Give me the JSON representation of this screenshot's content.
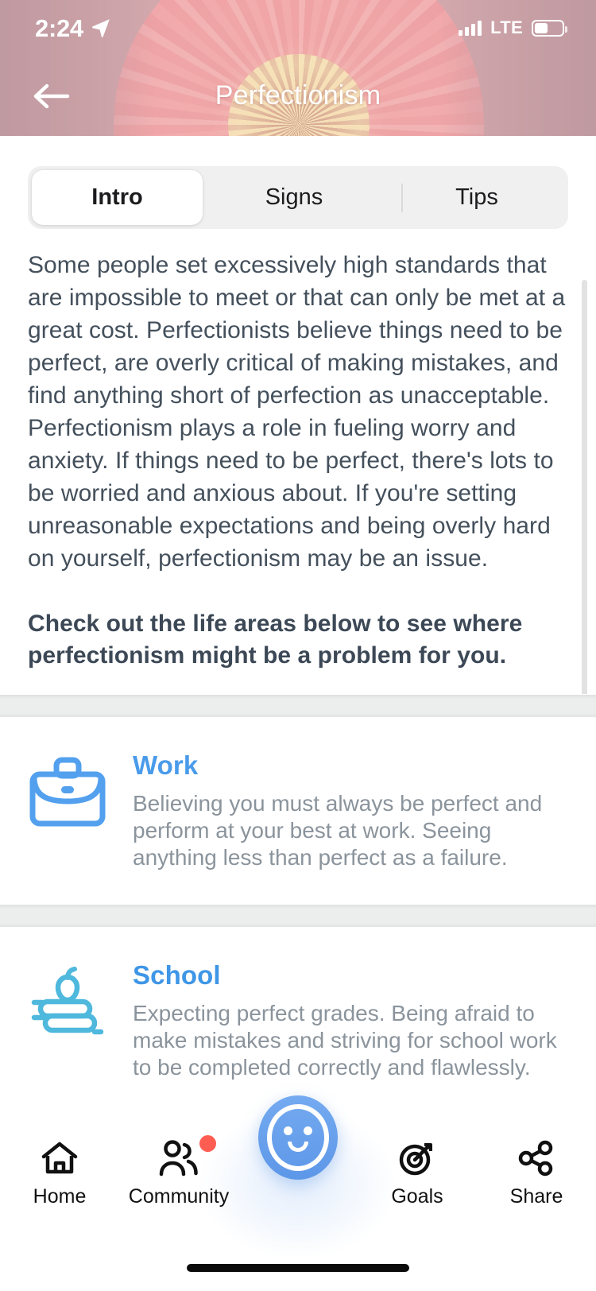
{
  "status_bar": {
    "time": "2:24",
    "location_icon": "location-arrow-icon",
    "signal_icon": "cellular-signal-icon",
    "network": "LTE",
    "battery_icon": "battery-icon"
  },
  "header": {
    "title": "Perfectionism",
    "back_icon": "back-arrow-icon",
    "background_image": "pink-zinnia-flower",
    "colors": {
      "overlay": "#b2838c",
      "flower_petal": "#ef8b8c",
      "flower_center": "#efe3b8"
    }
  },
  "tabs": [
    {
      "label": "Intro",
      "active": true
    },
    {
      "label": "Signs",
      "active": false
    },
    {
      "label": "Tips",
      "active": false
    }
  ],
  "intro": {
    "paragraph": "Some people set excessively high standards that are impossible to meet or that can only be met at a great cost. Perfectionists believe things need to be perfect, are overly critical of making mistakes, and find anything short of perfection as unacceptable. Perfectionism plays a role in fueling worry and anxiety. If things need to be perfect, there's lots to be worried and anxious about. If you're setting unreasonable expectations and being overly hard on yourself, perfectionism may be an issue.",
    "callout": "Check out the life areas below to see where perfectionism might be a problem for you."
  },
  "life_areas": [
    {
      "title": "Work",
      "icon": "briefcase-icon",
      "color": "#53a0ee",
      "description": "Believing you must always be perfect and perform at your best at work. Seeing anything less than perfect as a failure."
    },
    {
      "title": "School",
      "icon": "books-apple-icon",
      "color": "#4fb8dd",
      "description": "Expecting perfect grades. Being afraid to make mistakes and striving for school work to be completed correctly and flawlessly."
    }
  ],
  "bottom_nav": {
    "items": [
      {
        "label": "Home",
        "icon": "home-icon",
        "badge": false
      },
      {
        "label": "Community",
        "icon": "people-icon",
        "badge": true
      },
      {
        "label": "Goals",
        "icon": "target-icon",
        "badge": false
      },
      {
        "label": "Share",
        "icon": "share-nodes-icon",
        "badge": false
      }
    ],
    "center_button": {
      "icon": "smiley-face-icon",
      "color": "#5d97e8"
    },
    "badge_color": "#ff5d52"
  }
}
